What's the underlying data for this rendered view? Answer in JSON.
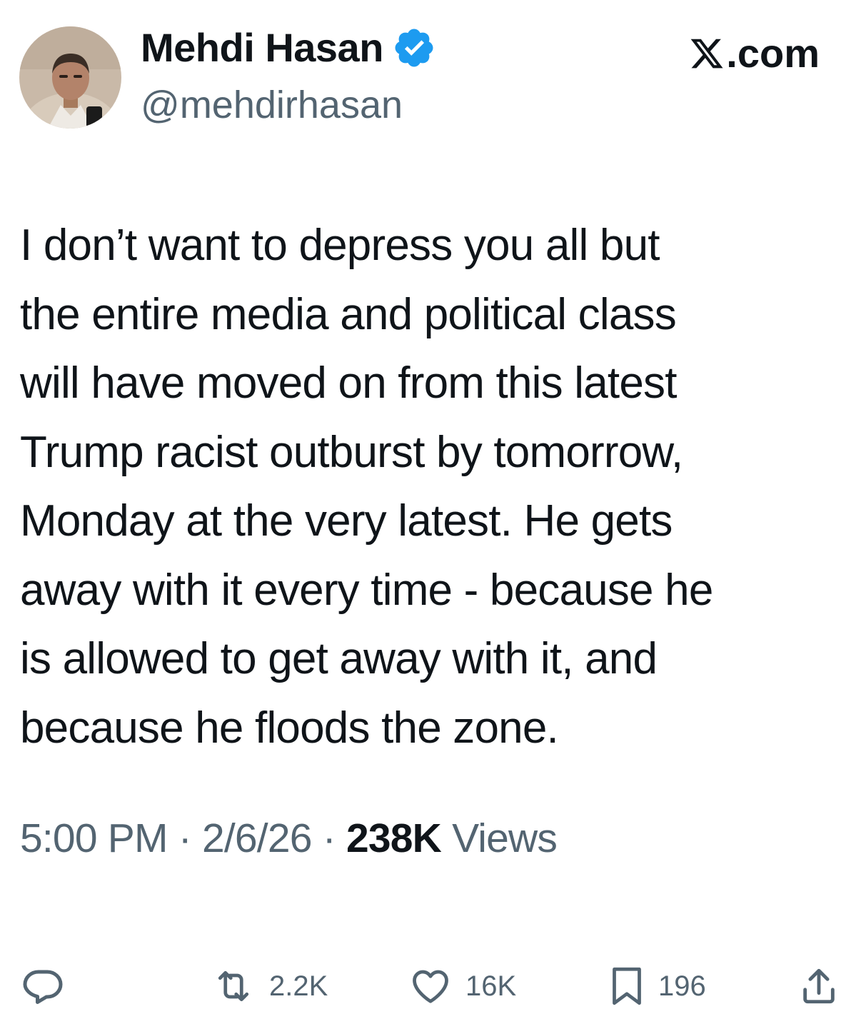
{
  "author": {
    "display_name": "Mehdi Hasan",
    "handle": "@mehdirhasan",
    "verified": true,
    "verified_color": "#1d9bf0"
  },
  "brand": {
    "suffix": ".com"
  },
  "tweet": {
    "text": "I don’t want to depress you all but\nthe entire media and political class\nwill have moved on from this latest\nTrump racist outburst by tomorrow,\nMonday at the very latest. He gets\naway with it every time - because he\nis allowed to get away with it, and\nbecause he floods the zone."
  },
  "meta": {
    "time": "5:00 PM",
    "separator": "·",
    "date": "2/6/26",
    "views_count": "238K",
    "views_label": "Views"
  },
  "actions": {
    "reply_icon": "reply-icon",
    "retweet_count": "2.2K",
    "like_count": "16K",
    "bookmark_count": "196",
    "share_icon": "share-icon"
  },
  "colors": {
    "text_primary": "#0f1419",
    "text_secondary": "#536471"
  }
}
